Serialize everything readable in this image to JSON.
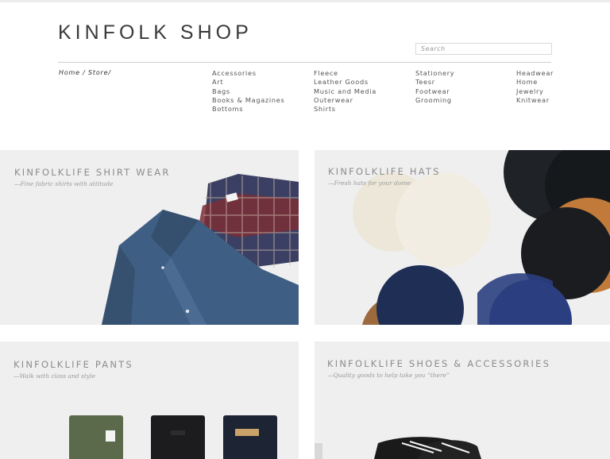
{
  "header": {
    "logo": "KINFOLK SHOP",
    "search_placeholder": "Search"
  },
  "breadcrumb": {
    "home": "Home",
    "sep1": " / ",
    "store": "Store",
    "sep2": "/"
  },
  "categories": {
    "col1": [
      "Accessories",
      "Art",
      "Bags",
      "Books & Magazines",
      "Bottoms"
    ],
    "col2": [
      "Fleece",
      "Leather Goods",
      "Music and Media",
      "Outerwear",
      "Shirts"
    ],
    "col3": [
      "Stationery",
      "Teesr",
      "Footwear",
      "Grooming"
    ],
    "col4": [
      "Headwear",
      "Home",
      "Jewelry",
      "Knitwear"
    ]
  },
  "tiles": [
    {
      "title": "KINFOLKLIFE SHIRT WEAR",
      "subtitle": "—Fine fabric shirts with attitude"
    },
    {
      "title": "KINFOLKLIFE HATS",
      "subtitle": "—Fresh hats for your dome"
    },
    {
      "title": "KINFOLKLIFE PANTS",
      "subtitle": "—Walk with class and style"
    },
    {
      "title": "KINFOLKLIFE SHOES & ACCESSORIES",
      "subtitle": "—Quality goods to help take you “there”"
    }
  ],
  "colors": {
    "tile_bg": "#efefef",
    "text_dark": "#3a3a3a",
    "tile_title": "#8c8c8c"
  }
}
